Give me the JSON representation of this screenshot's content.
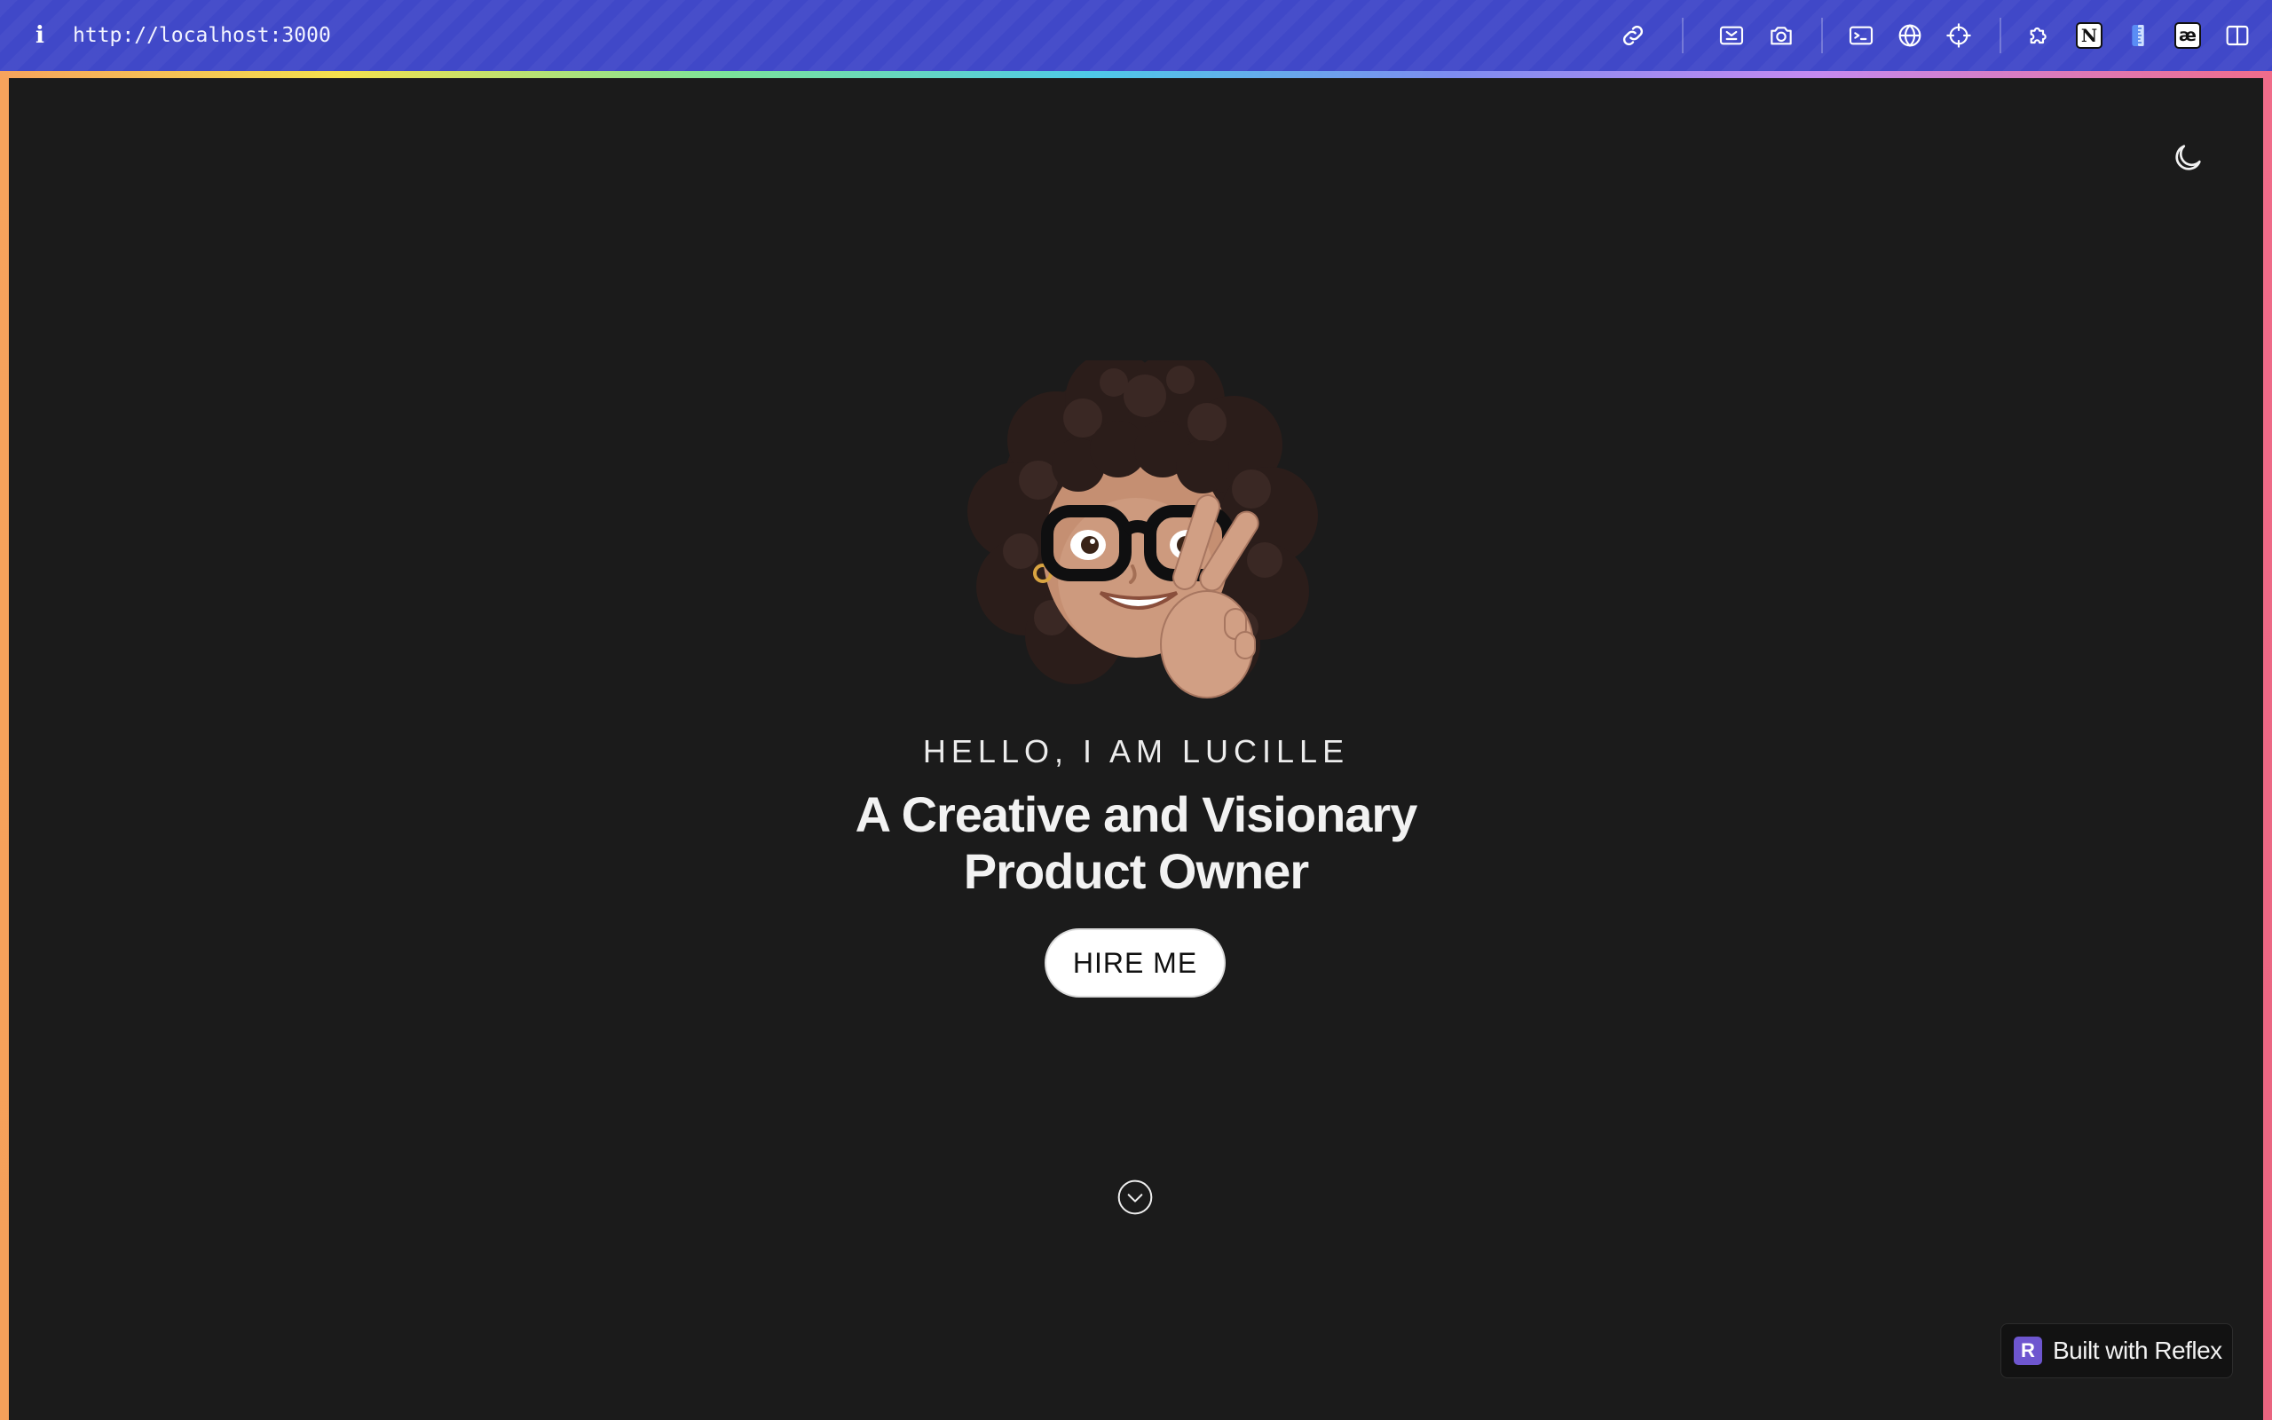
{
  "browser": {
    "info_label": "i",
    "url": "http://localhost:3000",
    "toolbar_icons": [
      "link-icon",
      "responsive-icon",
      "camera-icon",
      "terminal-icon",
      "globe-icon",
      "crosshair-icon",
      "puzzle-icon",
      "notion-icon",
      "ruler-icon",
      "ae-icon",
      "sidebar-icon"
    ],
    "notion_glyph": "N",
    "ae_glyph": "æ"
  },
  "colors": {
    "chrome": "#4048c8",
    "page_bg": "#1b1b1b",
    "accent": "#6e56cf"
  },
  "header": {
    "theme_toggle_icon": "moon-icon"
  },
  "hero": {
    "greeting": "HELLO, I AM LUCILLE",
    "headline_line1": "A Creative and Visionary",
    "headline_line2": "Product Owner",
    "cta_label": "HIRE ME",
    "scroll_icon": "chevron-down-circle-icon",
    "avatar_icon": "memoji-avatar-icon"
  },
  "badge": {
    "logo_letter": "R",
    "label": "Built with  Reflex"
  }
}
